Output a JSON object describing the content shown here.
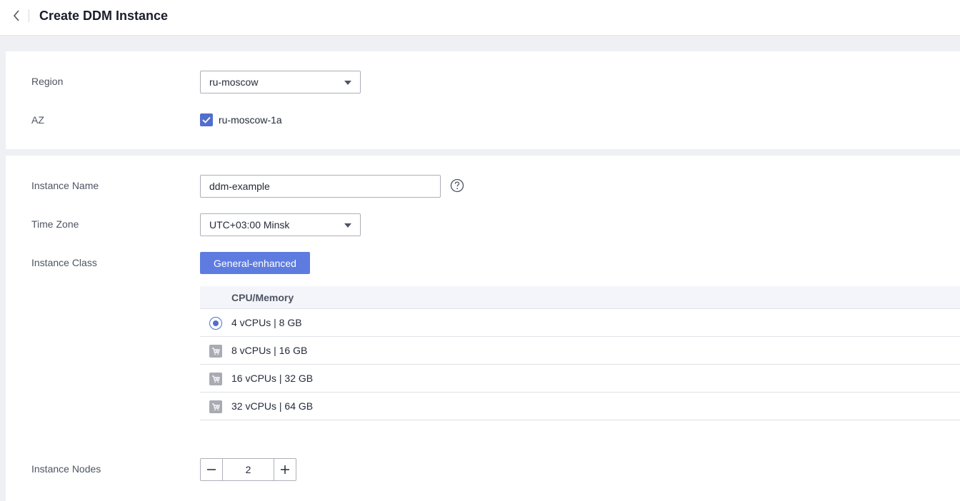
{
  "header": {
    "title": "Create DDM Instance",
    "back_icon": "chevron-left-icon"
  },
  "location": {
    "region_label": "Region",
    "region_value": "ru-moscow",
    "az_label": "AZ",
    "az_option": "ru-moscow-1a",
    "az_checked": true
  },
  "config": {
    "name_label": "Instance Name",
    "name_value": "ddm-example",
    "timezone_label": "Time Zone",
    "timezone_value": "UTC+03:00 Minsk",
    "class_label": "Instance Class",
    "class_button": "General-enhanced",
    "table_header": "CPU/Memory",
    "classes": [
      {
        "label": "4 vCPUs | 8 GB",
        "selected": true,
        "sold_out": false
      },
      {
        "label": "8 vCPUs | 16 GB",
        "selected": false,
        "sold_out": true
      },
      {
        "label": "16 vCPUs | 32 GB",
        "selected": false,
        "sold_out": true
      },
      {
        "label": "32 vCPUs | 64 GB",
        "selected": false,
        "sold_out": true
      }
    ],
    "nodes_label": "Instance Nodes",
    "nodes_value": "2"
  },
  "colors": {
    "accent": "#5e7ce0",
    "radio": "#526ecc",
    "disabled_icon": "#a8abb3"
  }
}
